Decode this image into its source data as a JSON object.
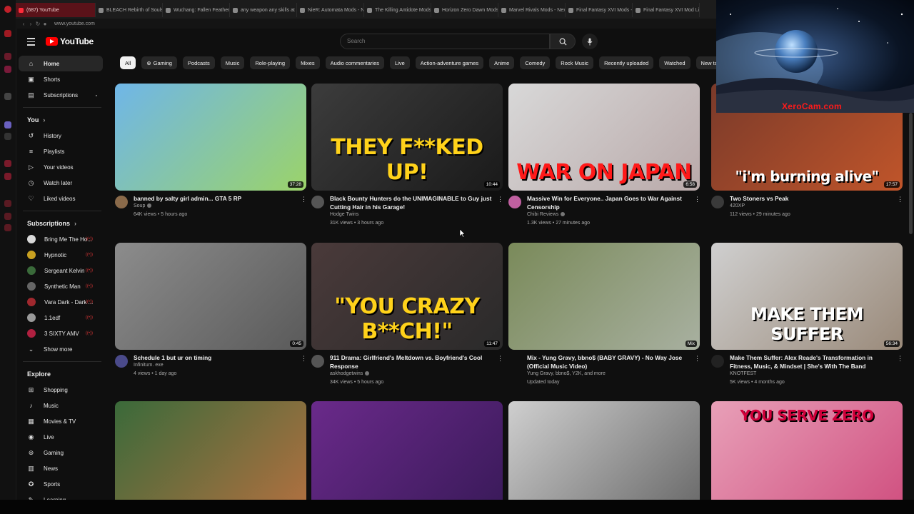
{
  "browser": {
    "tabs": [
      {
        "label": "(687) YouTube",
        "active": true
      },
      {
        "label": "BLEACH Rebirth of Souls"
      },
      {
        "label": "Wuchang: Fallen Feathers"
      },
      {
        "label": "any weapon any skills at"
      },
      {
        "label": "NieR: Automata Mods - N"
      },
      {
        "label": "The Killing Antidote Mods"
      },
      {
        "label": "Horizon Zero Dawn Mods"
      },
      {
        "label": "Marvel Rivals Mods - Nex"
      },
      {
        "label": "Final Fantasy XVI Mods -"
      },
      {
        "label": "Final Fantasy XVI Mod Li"
      }
    ],
    "url": "www.youtube.com"
  },
  "header": {
    "logo_text": "YouTube",
    "search_placeholder": "Search"
  },
  "sidebar": {
    "main": [
      {
        "label": "Home",
        "icon": "home-icon",
        "active": true
      },
      {
        "label": "Shorts",
        "icon": "shorts-icon"
      },
      {
        "label": "Subscriptions",
        "icon": "subscriptions-icon"
      }
    ],
    "you_heading": "You",
    "you": [
      {
        "label": "History",
        "icon": "history-icon"
      },
      {
        "label": "Playlists",
        "icon": "playlists-icon"
      },
      {
        "label": "Your videos",
        "icon": "your-videos-icon"
      },
      {
        "label": "Watch later",
        "icon": "watch-later-icon"
      },
      {
        "label": "Liked videos",
        "icon": "liked-icon"
      }
    ],
    "subscriptions_heading": "Subscriptions",
    "subscriptions": [
      {
        "label": "Bring Me The Ho...",
        "color": "#d9d9d9"
      },
      {
        "label": "Hypnotic",
        "color": "#c8a020"
      },
      {
        "label": "Sergeant Kelvin",
        "color": "#3a6a3a"
      },
      {
        "label": "Synthetic Man",
        "color": "#666666"
      },
      {
        "label": "Vara Dark - Dark ...",
        "color": "#a0282e"
      },
      {
        "label": "1.1edf",
        "color": "#9a9a9a"
      },
      {
        "label": "3 SIXTY AMV",
        "color": "#b02040"
      }
    ],
    "show_more": "Show more",
    "explore_heading": "Explore",
    "explore": [
      {
        "label": "Shopping",
        "icon": "shopping-icon"
      },
      {
        "label": "Music",
        "icon": "music-icon"
      },
      {
        "label": "Movies & TV",
        "icon": "movies-icon"
      },
      {
        "label": "Live",
        "icon": "live-icon"
      },
      {
        "label": "Gaming",
        "icon": "gaming-icon"
      },
      {
        "label": "News",
        "icon": "news-icon"
      },
      {
        "label": "Sports",
        "icon": "sports-icon"
      },
      {
        "label": "Learning",
        "icon": "learning-icon"
      }
    ]
  },
  "chips": [
    "All",
    "Gaming",
    "Podcasts",
    "Music",
    "Role-playing",
    "Mixes",
    "Audio commentaries",
    "Live",
    "Action-adventure games",
    "Anime",
    "Comedy",
    "Rock Music",
    "Recently uploaded",
    "Watched",
    "New to you"
  ],
  "videos": [
    {
      "title": "banned by salty girl admin... GTA 5 RP",
      "channel": "Soup",
      "stats": "64K views • 5 hours ago",
      "duration": "37:28",
      "thumb_text": "",
      "thumb_colors": [
        "#6fb6e8",
        "#9bd36a"
      ],
      "avatar": "#8a6a4a"
    },
    {
      "title": "Black Bounty Hunters do the UNIMAGINABLE to Guy just Cutting Hair in his Garage!",
      "channel": "Hodge Twins",
      "stats": "31K views • 3 hours ago",
      "duration": "10:44",
      "thumb_text": "THEY F**KED UP!",
      "thumb_colors": [
        "#3c3c3c",
        "#1a1a1a"
      ],
      "avatar": "#555"
    },
    {
      "title": "Massive Win for Everyone.. Japan Goes to War Against Censorship",
      "channel": "Chibi Reviews",
      "stats": "1.3K views • 27 minutes ago",
      "duration": "6:58",
      "thumb_text": "WAR ON JAPAN",
      "thumb_colors": [
        "#d8d8d8",
        "#b9a9a9"
      ],
      "avatar": "#c060a0"
    },
    {
      "title": "Two Stoners vs Peak",
      "channel": "420XP",
      "stats": "112 views • 29 minutes ago",
      "duration": "17:57",
      "thumb_text": "\"i'm burning alive\"",
      "thumb_colors": [
        "#7a3a2a",
        "#c0552a"
      ],
      "avatar": "#3a3a3a"
    },
    {
      "title": "Schedule 1 but ur on timing",
      "channel": "Infinitum. exe",
      "stats": "4 views • 1 day ago",
      "duration": "0:45",
      "thumb_text": "",
      "thumb_colors": [
        "#8c8c8c",
        "#5a5a5a"
      ],
      "avatar": "#4a4a8a"
    },
    {
      "title": "911 Drama: Girlfriend's Meltdown vs. Boyfriend's Cool Response",
      "channel": "askhodgetwins",
      "stats": "34K views • 5 hours ago",
      "duration": "11:47",
      "thumb_text": "\"YOU CRAZY B**CH!\"",
      "thumb_colors": [
        "#4a3a3a",
        "#2a2a2a"
      ],
      "avatar": "#555"
    },
    {
      "title": "Mix - Yung Gravy, bbno$ (BABY GRAVY) - No Way Jose (Official Music Video)",
      "channel": "Yung Gravy, bbno$, Y2K, and more",
      "stats": "Updated today",
      "duration": "Mix",
      "thumb_text": "",
      "thumb_colors": [
        "#7a8a5a",
        "#a8b0a0"
      ],
      "avatar": ""
    },
    {
      "title": "Make Them Suffer: Alex Reade's Transformation in Fitness, Music, & Mindset | She's With The Band",
      "channel": "KNOTFEST",
      "stats": "5K views • 4 months ago",
      "duration": "56:34",
      "thumb_text": "MAKE THEM SUFFER",
      "thumb_colors": [
        "#cfcfcf",
        "#9a8a7a"
      ],
      "avatar": "#222"
    },
    {
      "title": "",
      "channel": "",
      "stats": "",
      "duration": "",
      "thumb_text": "",
      "thumb_colors": [
        "#3a6a3a",
        "#b07040"
      ],
      "avatar": ""
    },
    {
      "title": "",
      "channel": "",
      "stats": "",
      "duration": "",
      "thumb_text": "",
      "thumb_colors": [
        "#6a2a8a",
        "#3a1a5a"
      ],
      "avatar": ""
    },
    {
      "title": "",
      "channel": "",
      "stats": "",
      "duration": "",
      "thumb_text": "",
      "thumb_colors": [
        "#cfcfcf",
        "#6a6a6a"
      ],
      "avatar": ""
    },
    {
      "title": "",
      "channel": "",
      "stats": "",
      "duration": "",
      "thumb_text": "YOU SERVE ZERO",
      "thumb_colors": [
        "#e8a0b8",
        "#d05080"
      ],
      "avatar": ""
    }
  ],
  "overlay": {
    "watermark": "XeroCam.com"
  }
}
